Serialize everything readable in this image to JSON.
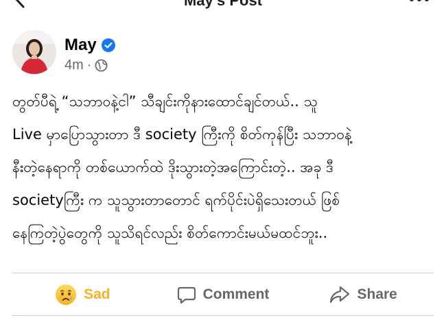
{
  "topbar": {
    "title": "May's Post"
  },
  "post": {
    "author": "May",
    "time": "4m",
    "separator": "·",
    "lines": [
      "တွတ်ပီရဲ့ “သဘာဝနဲ့ငါ” သီချင်းကိုနားထောင်ချင်တယ်.. သူ",
      "Live မှာပြောသွားတာ ဒီ society ကြီးကို စိတ်ကုန်ပြီး သဘာဝနဲ့",
      "နီးတဲ့နေရာကို တစ်ယောက်ထဲ ဒိုးသွားတဲ့အကြောင်းတဲ့.. အခု ဒီ",
      "societyကြီး က သူသွားတာတောင် ရက်ပိုင်းပဲရှိသေးတယ် ဖြစ်",
      "နေကြတဲ့ပွဲတွေကို သူသိရင်လည်း စိတ်ကောင်းမယ်မထင်ဘူး.."
    ]
  },
  "actions": {
    "reaction_label": "Sad",
    "comment_label": "Comment",
    "share_label": "Share"
  },
  "colors": {
    "verified": "#1877f2",
    "sad": "#f7b125",
    "muted": "#65676b"
  },
  "icons": [
    "back-arrow-icon",
    "more-icon",
    "verified-badge-icon",
    "globe-icon",
    "sad-emoji-icon",
    "comment-icon",
    "share-icon"
  ]
}
